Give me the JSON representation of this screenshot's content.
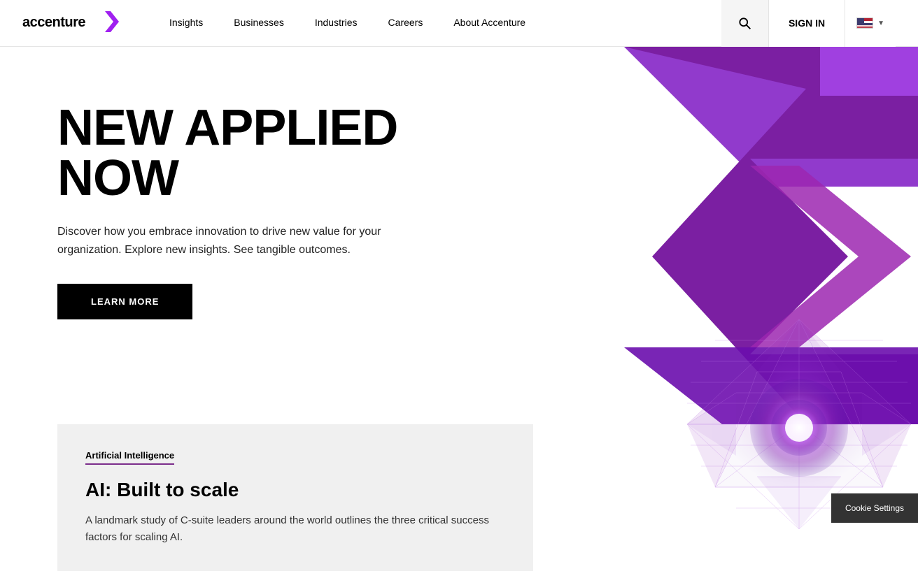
{
  "navbar": {
    "logo_text": "accenture",
    "nav_items": [
      {
        "label": "Insights",
        "id": "insights"
      },
      {
        "label": "Businesses",
        "id": "businesses"
      },
      {
        "label": "Industries",
        "id": "industries"
      },
      {
        "label": "Careers",
        "id": "careers"
      },
      {
        "label": "About Accenture",
        "id": "about"
      }
    ],
    "signin_label": "SIGN IN",
    "lang_label": "EN"
  },
  "hero": {
    "title": "NEW APPLIED NOW",
    "description": "Discover how you embrace innovation to drive new value for your organization. Explore new insights. See tangible outcomes.",
    "cta_label": "LEARN MORE"
  },
  "card": {
    "tag": "Artificial Intelligence",
    "title": "AI: Built to scale",
    "description": "A landmark study of C-suite leaders around the world outlines the three critical success factors for scaling AI."
  },
  "cookie": {
    "label": "Cookie Settings"
  },
  "colors": {
    "purple": "#7b2d8b",
    "purple_bright": "#a020f0",
    "black": "#000000",
    "white": "#ffffff"
  }
}
